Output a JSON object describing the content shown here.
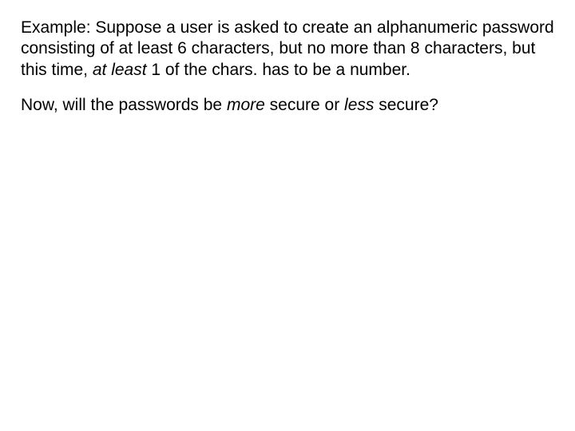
{
  "p1": {
    "t1": "Example: Suppose a user is asked to create an alphanumeric password consisting of at least 6 characters, but no more than 8 characters, but this time, ",
    "t2": "at least",
    "t3": " 1 of the chars. has to be a number."
  },
  "p2": {
    "t1": "Now, will the passwords be ",
    "t2": "more",
    "t3": " secure or ",
    "t4": "less",
    "t5": " secure?"
  }
}
